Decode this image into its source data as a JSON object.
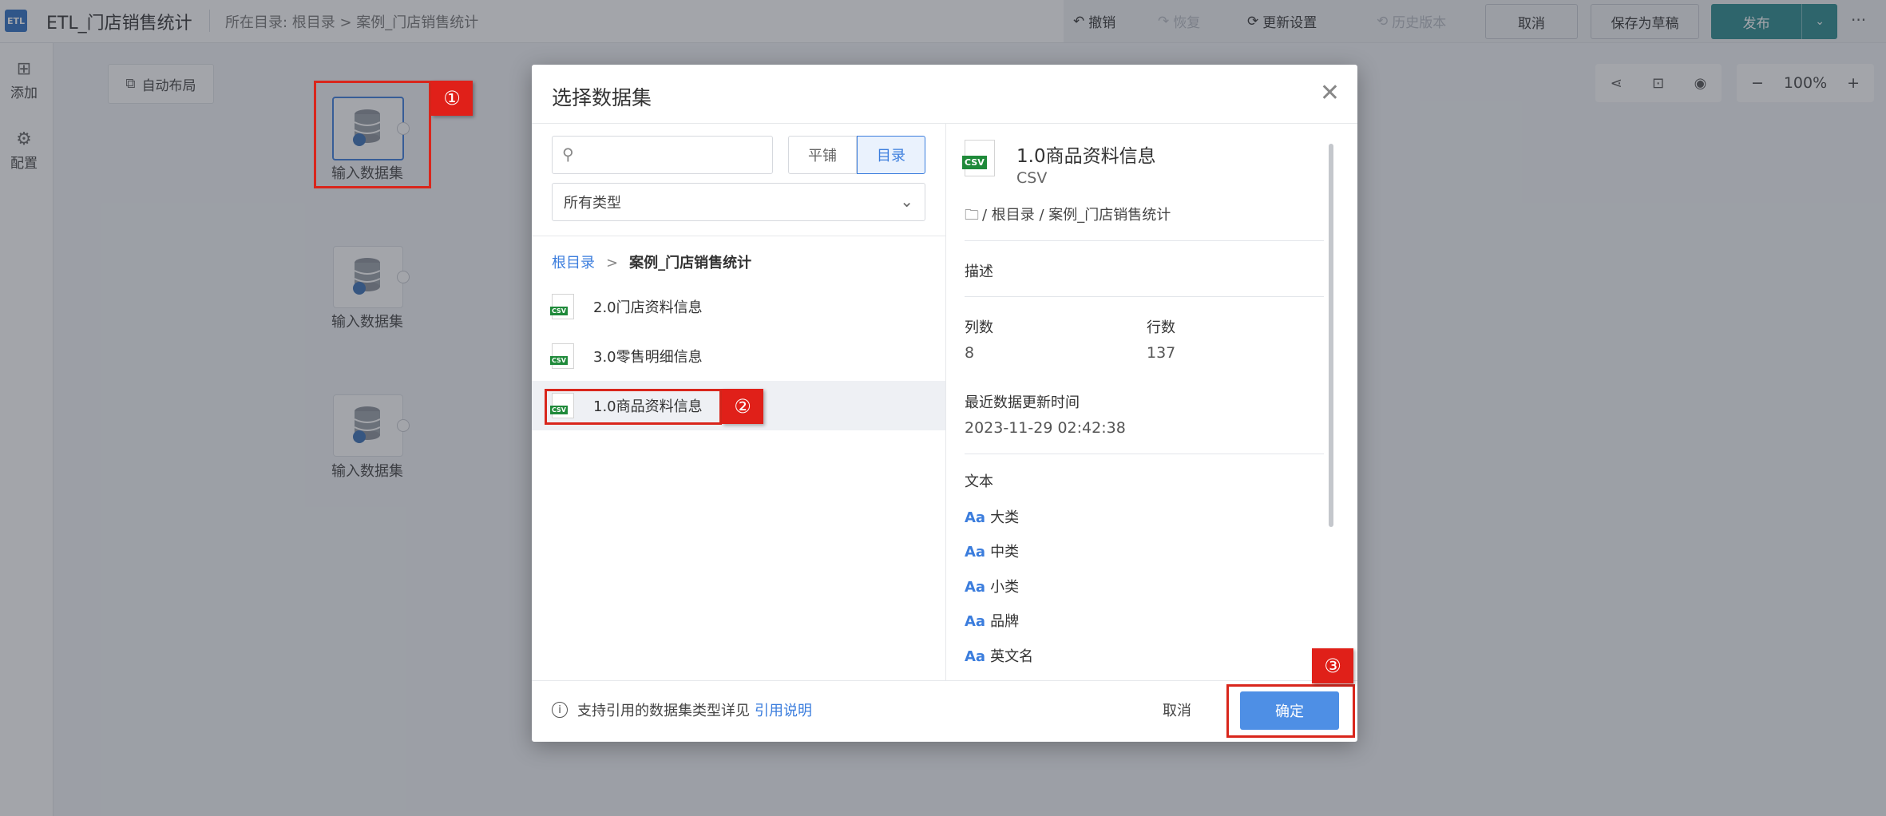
{
  "app": {
    "logo": "ETL",
    "title": "ETL_门店销售统计",
    "breadcrumb": "所在目录: 根目录 > 案例_门店销售统计"
  },
  "toolbar": {
    "undo": "撤销",
    "redo": "恢复",
    "update_settings": "更新设置",
    "history": "历史版本",
    "cancel": "取消",
    "save_draft": "保存为草稿",
    "publish": "发布",
    "more": "···"
  },
  "leftbar": {
    "add": "添加",
    "config": "配置"
  },
  "canvas": {
    "auto_layout": "自动布局",
    "nodes": [
      {
        "label": "输入数据集"
      },
      {
        "label": "输入数据集"
      },
      {
        "label": "输入数据集"
      }
    ],
    "zoom": "100%"
  },
  "dialog": {
    "title": "选择数据集",
    "search_placeholder": "",
    "view_flat": "平铺",
    "view_dir": "目录",
    "type_filter": "所有类型",
    "bc_root": "根目录",
    "bc_sep": ">",
    "bc_current": "案例_门店销售统计",
    "items": [
      {
        "name": "2.0门店资料信息",
        "icon": "CSV"
      },
      {
        "name": "3.0零售明细信息",
        "icon": "CSV"
      },
      {
        "name": "1.0商品资料信息",
        "icon": "CSV"
      }
    ],
    "detail": {
      "name": "1.0商品资料信息",
      "type": "CSV",
      "path": "/ 根目录 / 案例_门店销售统计",
      "desc_label": "描述",
      "cols_label": "列数",
      "cols": "8",
      "rows_label": "行数",
      "rows": "137",
      "updated_label": "最近数据更新时间",
      "updated": "2023-11-29 02:42:38",
      "text_label": "文本",
      "field_prefix": "Aa",
      "fields": [
        "大类",
        "中类",
        "小类",
        "品牌",
        "英文名"
      ]
    },
    "footer": {
      "info": "支持引用的数据集类型详见",
      "link": "引用说明",
      "cancel": "取消",
      "confirm": "确定"
    }
  },
  "annotations": [
    "①",
    "②",
    "③"
  ],
  "colors": {
    "accent": "#3b7ddd",
    "publish": "#2a8a8f",
    "annotation": "#e02019"
  }
}
